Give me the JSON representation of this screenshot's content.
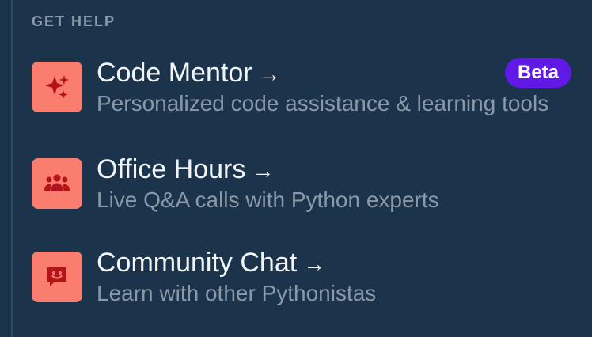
{
  "section": {
    "heading": "GET HELP"
  },
  "items": [
    {
      "title": "Code Mentor",
      "arrow": "→",
      "subtitle": "Personalized code assistance & learning tools",
      "badge": "Beta",
      "icon": "sparkles-icon"
    },
    {
      "title": "Office Hours",
      "arrow": "→",
      "subtitle": "Live Q&A calls with Python experts",
      "icon": "people-icon"
    },
    {
      "title": "Community Chat",
      "arrow": "→",
      "subtitle": "Learn with other Pythonistas",
      "icon": "chat-icon"
    }
  ],
  "colors": {
    "background": "#1b344c",
    "icon_tile": "#fa7d6f",
    "icon_glyph": "#b3131b",
    "title": "#f2f5f8",
    "subtitle": "#8999a9",
    "heading": "#8a9baa",
    "badge": "#6119e6"
  }
}
